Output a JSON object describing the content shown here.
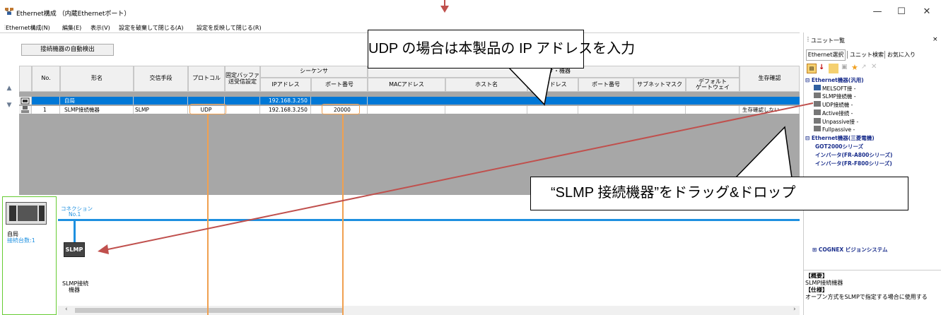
{
  "window": {
    "title": "Ethernet構成 （内蔵Ethernetポート）",
    "minimize": "—",
    "maximize": "☐",
    "close": "✕"
  },
  "menu": [
    "Ethernet構成(N)",
    "編集(E)",
    "表示(V)",
    "設定を破棄して閉じる(A)",
    "設定を反映して閉じる(R)"
  ],
  "toolbar": {
    "auto_detect": "接続機器の自動検出"
  },
  "table": {
    "headers": {
      "no": "No.",
      "model": "形名",
      "comm": "交信手段",
      "protocol": "プロトコル",
      "fixed_buffer": "固定バッファ\n送受信設定",
      "sequencer": "シーケンサ",
      "seq_ip": "IPアドレス",
      "seq_port": "ポート番号",
      "mac": "MACアドレス",
      "host": "ホスト名",
      "sensor": "センサ・機器",
      "ip": "IPアドレス",
      "port": "ポート番号",
      "subnet": "サブネットマスク",
      "gateway": "デフォルト\nゲートウェイ",
      "alive": "生存確認"
    },
    "rows": [
      {
        "no": "",
        "model": "自局",
        "comm": "",
        "protocol": "",
        "seq_ip": "192.168.3.250",
        "seq_port": "",
        "alive": ""
      },
      {
        "no": "1",
        "model": "SLMP接続機器",
        "comm": "SLMP",
        "protocol": "UDP",
        "seq_ip": "192.168.3.250",
        "seq_port": "20000",
        "alive": "生存確認しない"
      }
    ]
  },
  "diagram": {
    "connection": "コネクション",
    "connection_no": "No.1",
    "host_label": "自局",
    "host_count": "接続台数:1",
    "slmp_icon": "SLMP",
    "slmp_label": "SLMP接続\n機器"
  },
  "panel": {
    "title": "ユニット一覧",
    "close": "×",
    "tabs": [
      "Ethernet選択",
      "ユニット検索",
      "お気に入り"
    ],
    "tree": [
      {
        "label": "Ethernet機器(汎用)",
        "type": "group",
        "expander": "⊟"
      },
      {
        "label": "MELSOFT接",
        "type": "item"
      },
      {
        "label": "SLMP接続機",
        "type": "item"
      },
      {
        "label": "UDP接続機",
        "type": "item"
      },
      {
        "label": "Active接続",
        "type": "item"
      },
      {
        "label": "Unpassive接",
        "type": "item"
      },
      {
        "label": "Fullpassive",
        "type": "item"
      },
      {
        "label": "Ethernet機器(三菱電機)",
        "type": "group",
        "expander": "⊟"
      },
      {
        "label": "GOT2000シリーズ",
        "type": "subgroup"
      },
      {
        "label": "インバータ(FR-A800シリーズ)",
        "type": "subgroup"
      },
      {
        "label": "インバータ(FR-F800シリーズ)",
        "type": "subgroup"
      },
      {
        "label": "COGNEX ビジョンシステム",
        "type": "group",
        "expander": "⊞"
      }
    ],
    "summary_title": "【概要】",
    "summary": "SLMP接続機器",
    "spec_title": "【仕様】",
    "spec": "オープン方式をSLMPで指定する場合に使用する"
  },
  "callouts": {
    "udp_ip": "UDP の場合は本製品の IP アドレスを入力",
    "drag": "“SLMP 接続機器”をドラッグ&ドロップ"
  },
  "colors": {
    "highlight": "#0078d7",
    "orange": "#f0a050",
    "arrow": "#c0504d",
    "conn_line": "#1e90e0",
    "group_text": "#1a2e8c",
    "green_border": "#66cc33"
  }
}
